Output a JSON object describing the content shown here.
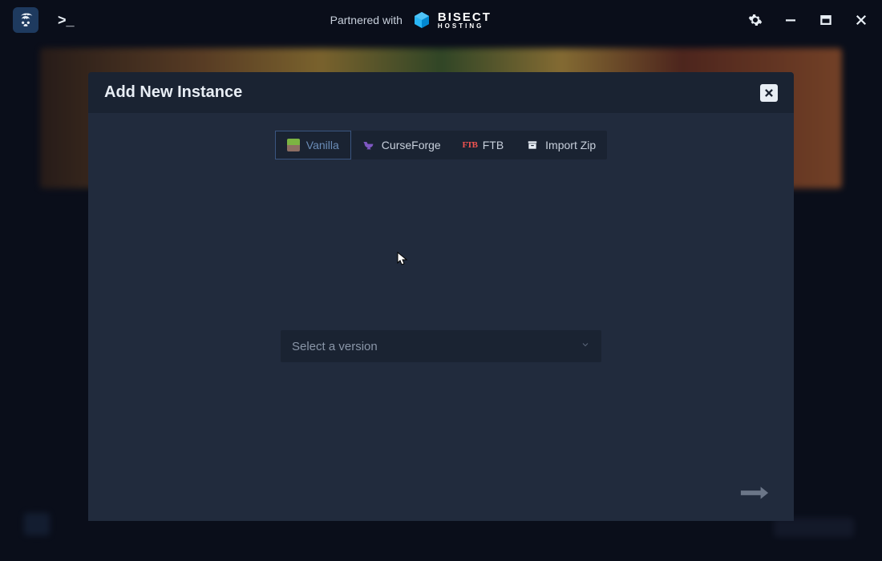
{
  "titlebar": {
    "partnered_text": "Partnered with",
    "bisect_main": "BISECT",
    "bisect_sub": "HOSTING"
  },
  "modal": {
    "title": "Add New Instance",
    "tabs": [
      {
        "label": "Vanilla",
        "active": true
      },
      {
        "label": "CurseForge",
        "active": false
      },
      {
        "label": "FTB",
        "active": false
      },
      {
        "label": "Import Zip",
        "active": false
      }
    ],
    "version_placeholder": "Select a version"
  }
}
